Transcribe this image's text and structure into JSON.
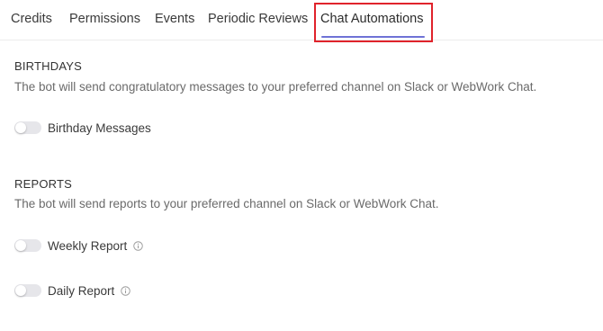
{
  "tabs": [
    {
      "label": "Credits"
    },
    {
      "label": "Permissions"
    },
    {
      "label": "Events"
    },
    {
      "label": "Periodic Reviews"
    },
    {
      "label": "Chat Automations",
      "active": true
    }
  ],
  "colors": {
    "accent": "#6e72d6",
    "highlight": "#e0232b",
    "toggle_off": "#e6e6ea"
  },
  "birthdays": {
    "title": "BIRTHDAYS",
    "description": "The bot will send congratulatory messages to your preferred channel on Slack or WebWork Chat.",
    "toggles": [
      {
        "label": "Birthday Messages",
        "enabled": false
      }
    ]
  },
  "reports": {
    "title": "REPORTS",
    "description": "The bot will send reports to your preferred channel on Slack or WebWork Chat.",
    "toggles": [
      {
        "label": "Weekly Report",
        "enabled": false,
        "icon": "info-icon"
      },
      {
        "label": "Daily Report",
        "enabled": false,
        "icon": "info-icon"
      }
    ]
  }
}
